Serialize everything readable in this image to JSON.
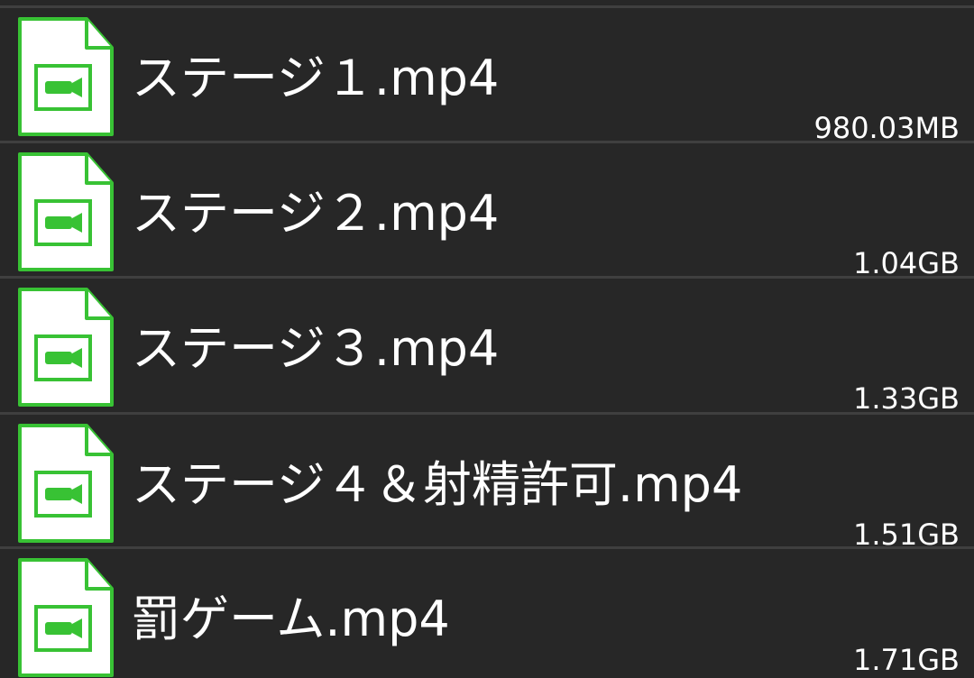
{
  "colors": {
    "background": "#272727",
    "divider": "#3f3f3f",
    "text": "#ffffff",
    "icon_accent": "#38c234"
  },
  "files": [
    {
      "name": "ステージ１.mp4",
      "size": "980.03MB",
      "icon": "video-file-icon"
    },
    {
      "name": "ステージ２.mp4",
      "size": "1.04GB",
      "icon": "video-file-icon"
    },
    {
      "name": "ステージ３.mp4",
      "size": "1.33GB",
      "icon": "video-file-icon"
    },
    {
      "name": "ステージ４＆射精許可.mp4",
      "size": "1.51GB",
      "icon": "video-file-icon"
    },
    {
      "name": "罰ゲーム.mp4",
      "size": "1.71GB",
      "icon": "video-file-icon"
    }
  ]
}
